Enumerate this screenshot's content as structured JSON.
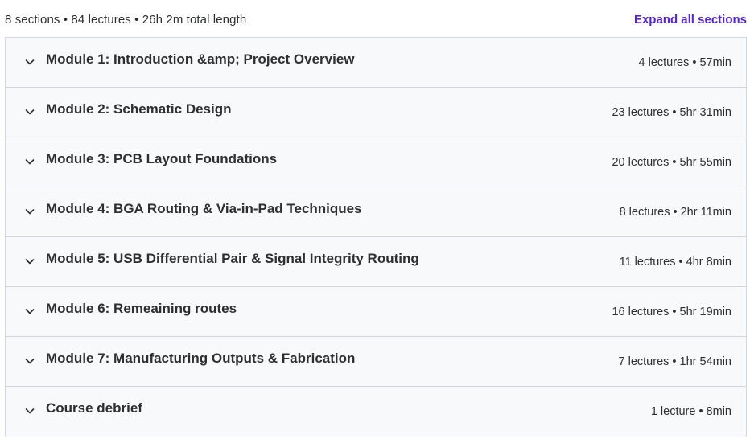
{
  "summary": {
    "text": "8 sections • 84 lectures • 26h 2m total length",
    "expand_all_label": "Expand all sections"
  },
  "colors": {
    "accent": "#5624d0",
    "row_background": "#f7f9fa",
    "border": "#d1d7dc",
    "text": "#2d2f31"
  },
  "sections": [
    {
      "title": "Module 1: Introduction &amp; Project Overview",
      "meta": "4 lectures • 57min",
      "icon": "chevron-down-icon"
    },
    {
      "title": "Module 2: Schematic Design",
      "meta": "23 lectures • 5hr 31min",
      "icon": "chevron-down-icon"
    },
    {
      "title": "Module 3: PCB Layout Foundations",
      "meta": "20 lectures • 5hr 55min",
      "icon": "chevron-down-icon"
    },
    {
      "title": "Module 4: BGA Routing & Via-in-Pad Techniques",
      "meta": "8 lectures • 2hr 11min",
      "icon": "chevron-down-icon"
    },
    {
      "title": "Module 5: USB Differential Pair & Signal Integrity Routing",
      "meta": "11 lectures • 4hr 8min",
      "icon": "chevron-down-icon"
    },
    {
      "title": "Module 6: Remeaining routes",
      "meta": "16 lectures • 5hr 19min",
      "icon": "chevron-down-icon"
    },
    {
      "title": "Module 7: Manufacturing Outputs & Fabrication",
      "meta": "7 lectures • 1hr 54min",
      "icon": "chevron-down-icon"
    },
    {
      "title": "Course debrief",
      "meta": "1 lecture • 8min",
      "icon": "chevron-down-icon"
    }
  ]
}
